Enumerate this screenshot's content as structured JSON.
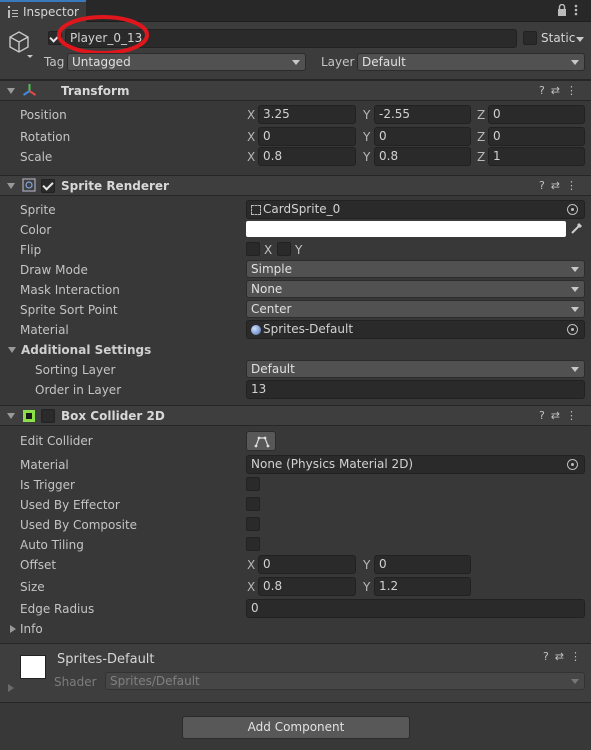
{
  "tab": {
    "title": "Inspector"
  },
  "gameobject": {
    "name": "Player_0_13",
    "static_label": "Static",
    "tag_label": "Tag",
    "tag_value": "Untagged",
    "layer_label": "Layer",
    "layer_value": "Default"
  },
  "transform": {
    "title": "Transform",
    "position": {
      "label": "Position",
      "x": "3.25",
      "y": "-2.55",
      "z": "0"
    },
    "rotation": {
      "label": "Rotation",
      "x": "0",
      "y": "0",
      "z": "0"
    },
    "scale": {
      "label": "Scale",
      "x": "0.8",
      "y": "0.8",
      "z": "1"
    }
  },
  "sprite_renderer": {
    "title": "Sprite Renderer",
    "sprite_label": "Sprite",
    "sprite_value": "CardSprite_0",
    "color_label": "Color",
    "flip_label": "Flip",
    "flip_x": "X",
    "flip_y": "Y",
    "draw_mode_label": "Draw Mode",
    "draw_mode_value": "Simple",
    "mask_label": "Mask Interaction",
    "mask_value": "None",
    "sort_point_label": "Sprite Sort Point",
    "sort_point_value": "Center",
    "material_label": "Material",
    "material_value": "Sprites-Default",
    "additional_label": "Additional Settings",
    "sorting_layer_label": "Sorting Layer",
    "sorting_layer_value": "Default",
    "order_label": "Order in Layer",
    "order_value": "13"
  },
  "box_collider": {
    "title": "Box Collider 2D",
    "edit_label": "Edit Collider",
    "material_label": "Material",
    "material_value": "None (Physics Material 2D)",
    "trigger_label": "Is Trigger",
    "effector_label": "Used By Effector",
    "composite_label": "Used By Composite",
    "autotiling_label": "Auto Tiling",
    "offset_label": "Offset",
    "offset_x": "0",
    "offset_y": "0",
    "size_label": "Size",
    "size_x": "0.8",
    "size_y": "1.2",
    "edge_label": "Edge Radius",
    "edge_value": "0",
    "info_label": "Info"
  },
  "material_preview": {
    "name": "Sprites-Default",
    "shader_label": "Shader",
    "shader_value": "Sprites/Default"
  },
  "add_component": "Add Component",
  "axes": {
    "x": "X",
    "y": "Y",
    "z": "Z"
  },
  "colors": {
    "annotation": "#e0161d",
    "panel": "#383838",
    "header": "#3e3e3e",
    "field": "#2a2a2a"
  }
}
